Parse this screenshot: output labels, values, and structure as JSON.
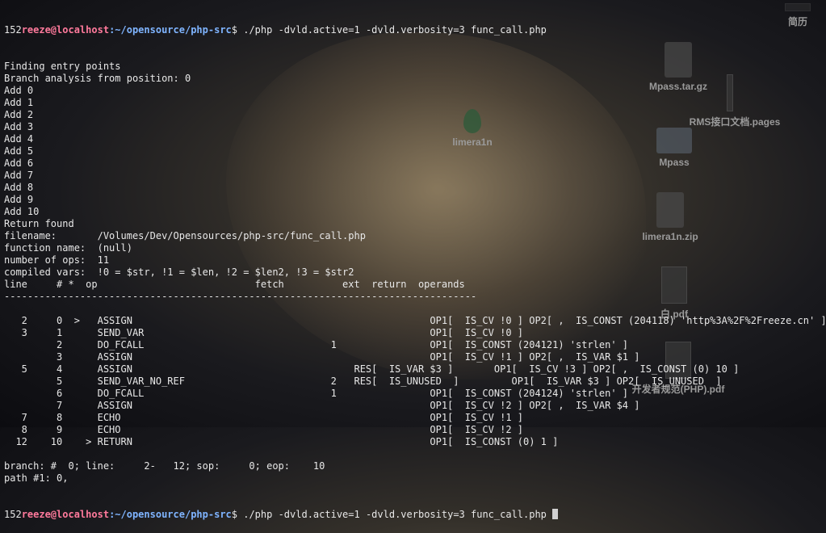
{
  "desktop": {
    "icons": [
      {
        "label": "简历"
      },
      {
        "label": "Mpass.tar.gz"
      },
      {
        "label": "RMS接口文档.pages"
      },
      {
        "label": "limera1n"
      },
      {
        "label": "Mpass"
      },
      {
        "label": "limera1n.zip"
      },
      {
        "label": "白.pdf"
      },
      {
        "label": "开发者规范(PHP).pdf"
      }
    ]
  },
  "terminal": {
    "prompt1": {
      "prefix": "152",
      "user": "reeze@localhost",
      "path": ":~/opensource/php-src",
      "command": "$ ./php -dvld.active=1 -dvld.verbosity=3 func_call.php"
    },
    "lines": [
      "Finding entry points",
      "Branch analysis from position: 0",
      "Add 0",
      "Add 1",
      "Add 2",
      "Add 3",
      "Add 4",
      "Add 5",
      "Add 6",
      "Add 7",
      "Add 8",
      "Add 9",
      "Add 10",
      "Return found",
      "filename:       /Volumes/Dev/Opensources/php-src/func_call.php",
      "function name:  (null)",
      "number of ops:  11",
      "compiled vars:  !0 = $str, !1 = $len, !2 = $len2, !3 = $str2",
      "line     # *  op                           fetch          ext  return  operands",
      "---------------------------------------------------------------------------------",
      "",
      "   2     0  >   ASSIGN                                                   OP1[  IS_CV !0 ] OP2[ ,  IS_CONST (204118) 'http%3A%2F%2Freeze.cn' ]",
      "   3     1      SEND_VAR                                                 OP1[  IS_CV !0 ]",
      "         2      DO_FCALL                                1                OP1[  IS_CONST (204121) 'strlen' ]",
      "         3      ASSIGN                                                   OP1[  IS_CV !1 ] OP2[ ,  IS_VAR $1 ]",
      "   5     4      ASSIGN                                      RES[  IS_VAR $3 ]       OP1[  IS_CV !3 ] OP2[ ,  IS_CONST (0) 10 ]",
      "         5      SEND_VAR_NO_REF                         2   RES[  IS_UNUSED  ]         OP1[  IS_VAR $3 ] OP2[  IS_UNUSED  ]",
      "         6      DO_FCALL                                1                OP1[  IS_CONST (204124) 'strlen' ]",
      "         7      ASSIGN                                                   OP1[  IS_CV !2 ] OP2[ ,  IS_VAR $4 ]",
      "   7     8      ECHO                                                     OP1[  IS_CV !1 ]",
      "   8     9      ECHO                                                     OP1[  IS_CV !2 ]",
      "  12    10    > RETURN                                                   OP1[  IS_CONST (0) 1 ]",
      "",
      "branch: #  0; line:     2-   12; sop:     0; eop:    10",
      "path #1: 0,"
    ],
    "prompt2": {
      "prefix": "152",
      "user": "reeze@localhost",
      "path": ":~/opensource/php-src",
      "command": "$ ./php -dvld.active=1 -dvld.verbosity=3 func_call.php "
    }
  }
}
